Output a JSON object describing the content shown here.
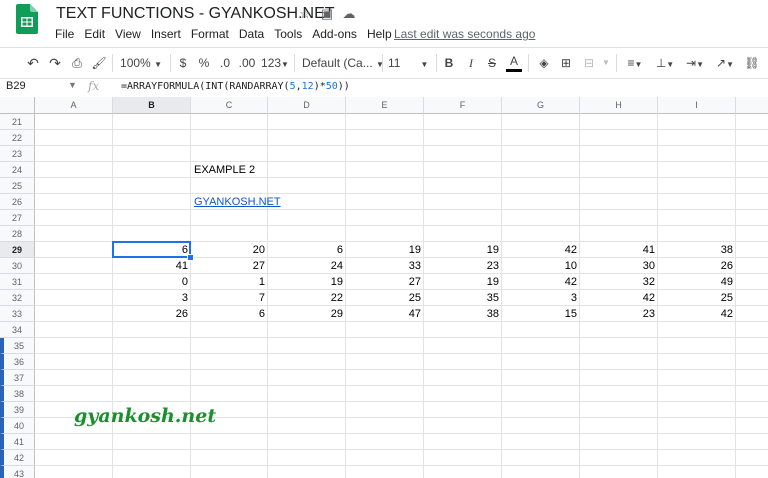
{
  "doc": {
    "title": "TEXT FUNCTIONS - GYANKOSH.NET",
    "last_edit": "Last edit was seconds ago"
  },
  "menu": [
    "File",
    "Edit",
    "View",
    "Insert",
    "Format",
    "Data",
    "Tools",
    "Add-ons",
    "Help"
  ],
  "toolbar": {
    "zoom": "100%",
    "currency": "$",
    "percent": "%",
    "dec_decrease": ".0",
    "dec_increase": ".00",
    "more_formats": "123",
    "font": "Default (Ca...",
    "font_size": "11",
    "bold": "B",
    "italic": "I",
    "strike": "S",
    "text_color": "A"
  },
  "formula_bar": {
    "cell_ref": "B29",
    "formula_prefix": "=ARRAYFORMULA(INT(RANDARRAY(",
    "arg1": "5",
    "comma": ",",
    "arg2": "12",
    "mid": ")*",
    "arg3": "50",
    "suffix": "))"
  },
  "columns": [
    "A",
    "B",
    "C",
    "D",
    "E",
    "F",
    "G",
    "H",
    "I"
  ],
  "rows": [
    "21",
    "22",
    "23",
    "24",
    "25",
    "26",
    "27",
    "28",
    "29",
    "30",
    "31",
    "32",
    "33",
    "34",
    "35",
    "36",
    "37",
    "38",
    "39",
    "40",
    "41",
    "42",
    "43"
  ],
  "cells": {
    "example_label": "EXAMPLE 2",
    "link_text": "GYANKOSH.NET",
    "data": [
      [
        "6",
        "20",
        "6",
        "19",
        "19",
        "42",
        "41",
        "38"
      ],
      [
        "41",
        "27",
        "24",
        "33",
        "23",
        "10",
        "30",
        "26"
      ],
      [
        "0",
        "1",
        "19",
        "27",
        "19",
        "42",
        "32",
        "49"
      ],
      [
        "3",
        "7",
        "22",
        "25",
        "35",
        "3",
        "42",
        "25"
      ],
      [
        "26",
        "6",
        "29",
        "47",
        "38",
        "15",
        "23",
        "42"
      ]
    ]
  },
  "watermark": "gyankosh.net",
  "colors": {
    "selection": "#1a73e8",
    "link": "#1155cc",
    "watermark": "#1a8f2e",
    "sheets_green": "#0f9d58"
  }
}
